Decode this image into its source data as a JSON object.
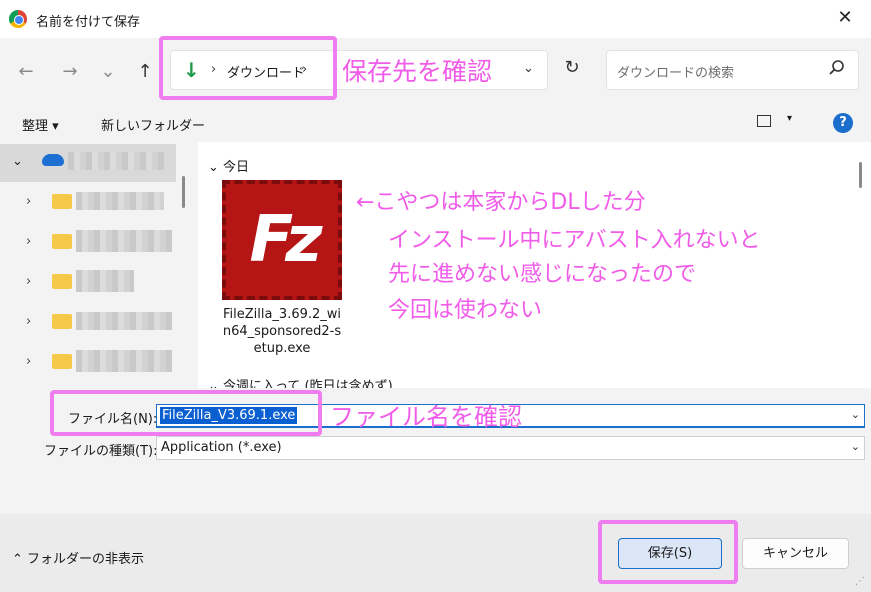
{
  "window": {
    "title": "名前を付けて保存",
    "close_glyph": "✕"
  },
  "nav": {
    "back": "←",
    "forward": "→",
    "recent": "⌄",
    "up": "↑",
    "refresh": "↻"
  },
  "address": {
    "icon": "↓",
    "separator": "›",
    "crumb": "ダウンロード",
    "dropdown": "⌄"
  },
  "search": {
    "placeholder": "ダウンロードの検索"
  },
  "toolbar": {
    "organize": "整理 ▾",
    "new_folder": "新しいフォルダー",
    "view_dropdown": "▾",
    "help": "?"
  },
  "content": {
    "group_today": "今日",
    "group_thisweek": "今週に入って (昨日は含めず)",
    "file": {
      "name": "FileZilla_3.69.2_win64_sponsored2-setup.exe",
      "icon_letters": "Fz"
    }
  },
  "form": {
    "filename_label": "ファイル名(N):",
    "filename_value": "FileZilla_V3.69.1.exe",
    "filetype_label": "ファイルの種類(T):",
    "filetype_value": "Application (*.exe)"
  },
  "footer": {
    "hide_folders": "フォルダーの非表示",
    "save": "保存(S)",
    "cancel": "キャンセル"
  },
  "annotations": {
    "save_location": "保存先を確認",
    "filename": "ファイル名を確認",
    "note_lines": [
      "←こやつは本家からDLした分",
      "インストール中にアバスト入れないと",
      "先に進めない感じになったので",
      "今回は使わない"
    ]
  },
  "colors": {
    "accent": "#1b6ecb",
    "annotation": "#f07df0",
    "filezilla_red": "#b51515"
  }
}
